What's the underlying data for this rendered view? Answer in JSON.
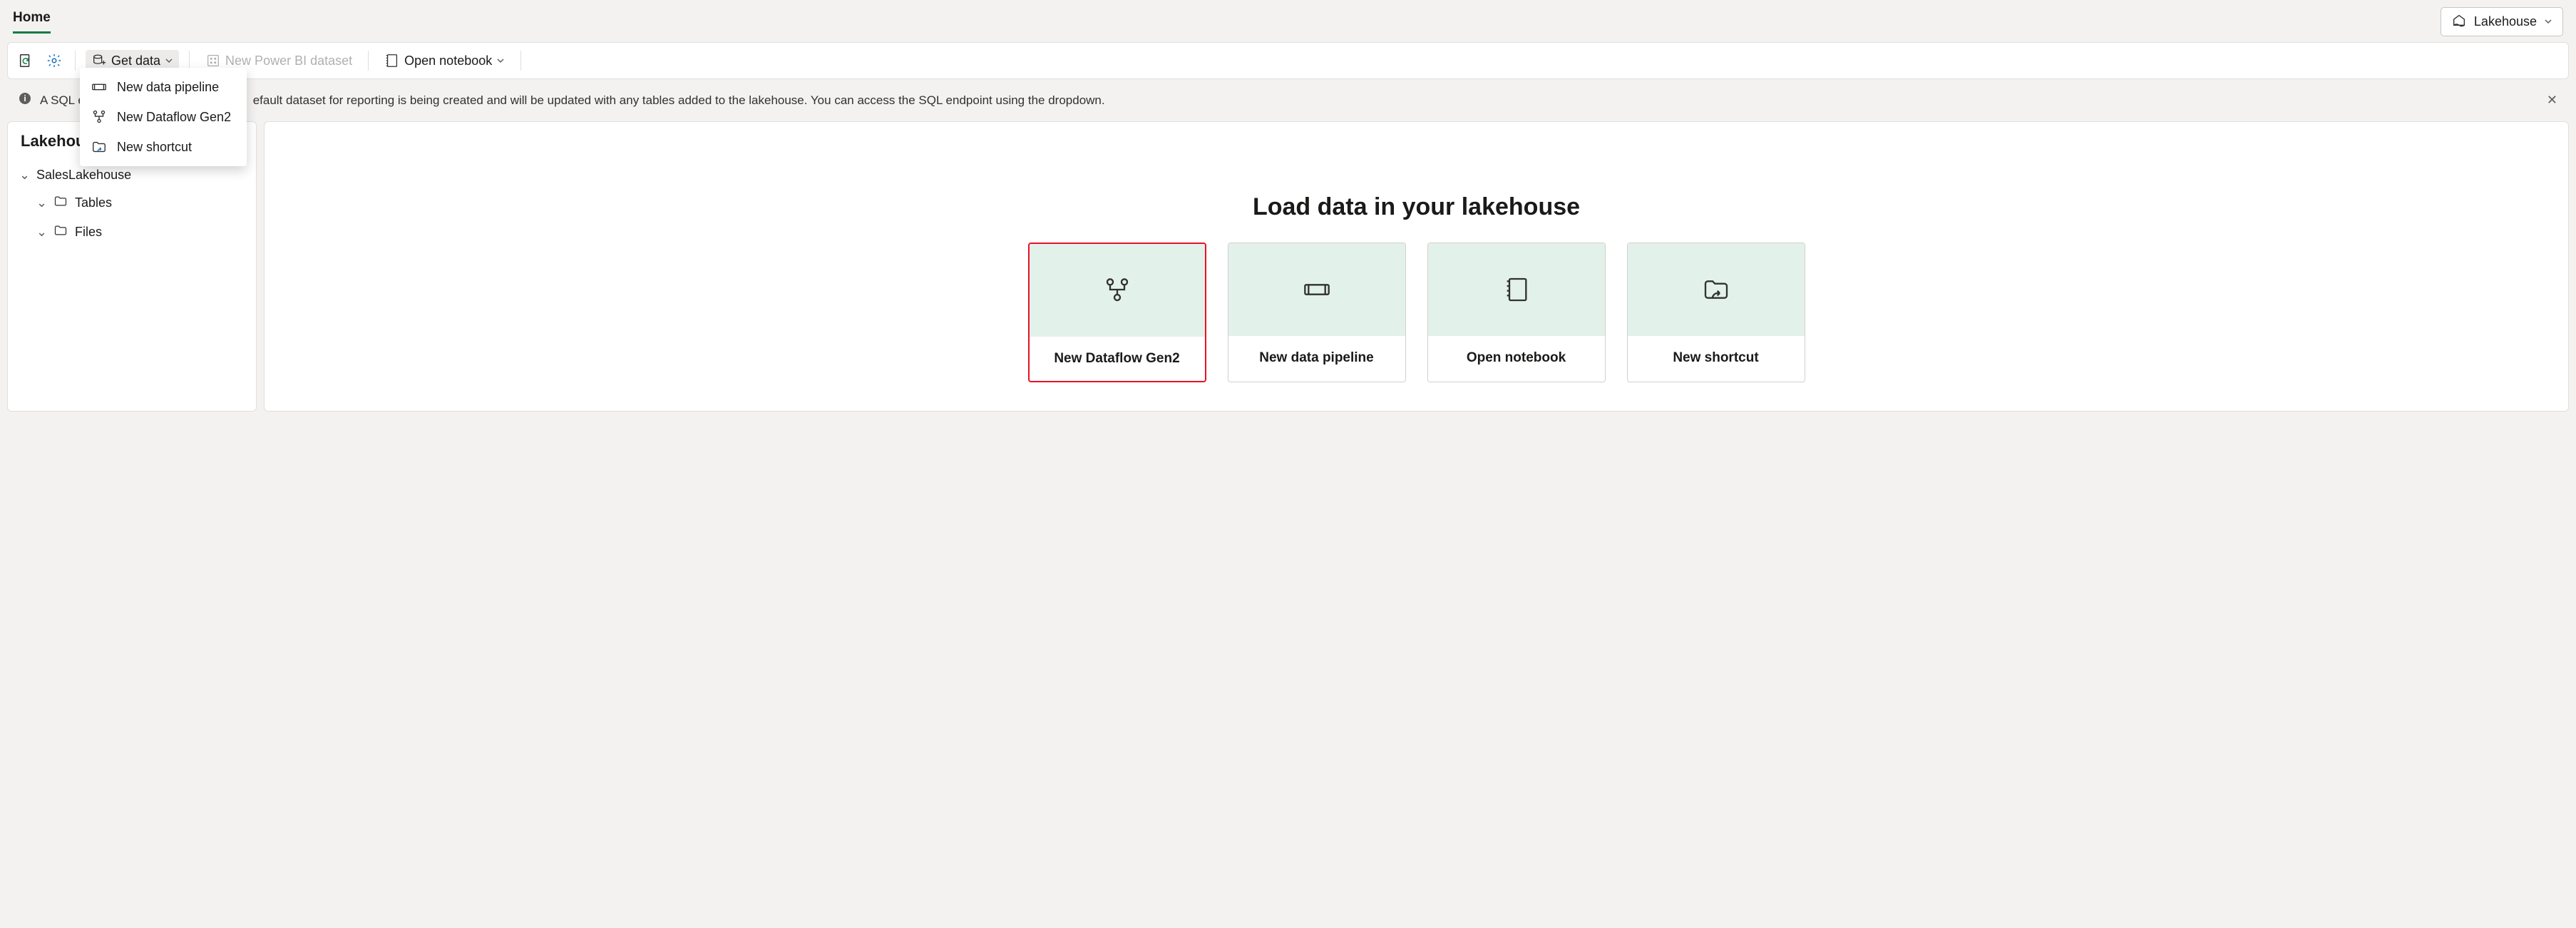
{
  "header": {
    "home_label": "Home",
    "mode_label": "Lakehouse"
  },
  "toolbar": {
    "get_data_label": "Get data",
    "new_dataset_label": "New Power BI dataset",
    "open_notebook_label": "Open notebook"
  },
  "dropdown": {
    "items": [
      "New data pipeline",
      "New Dataflow Gen2",
      "New shortcut"
    ]
  },
  "banner": {
    "prefix": "A SQL e",
    "suffix": "efault dataset for reporting is being created and will be updated with any tables added to the lakehouse. You can access the SQL endpoint using the dropdown."
  },
  "explorer": {
    "title": "Lakehous",
    "root": "SalesLakehouse",
    "nodes": [
      "Tables",
      "Files"
    ]
  },
  "main": {
    "title": "Load data in your lakehouse",
    "cards": [
      "New Dataflow Gen2",
      "New data pipeline",
      "Open notebook",
      "New shortcut"
    ]
  }
}
